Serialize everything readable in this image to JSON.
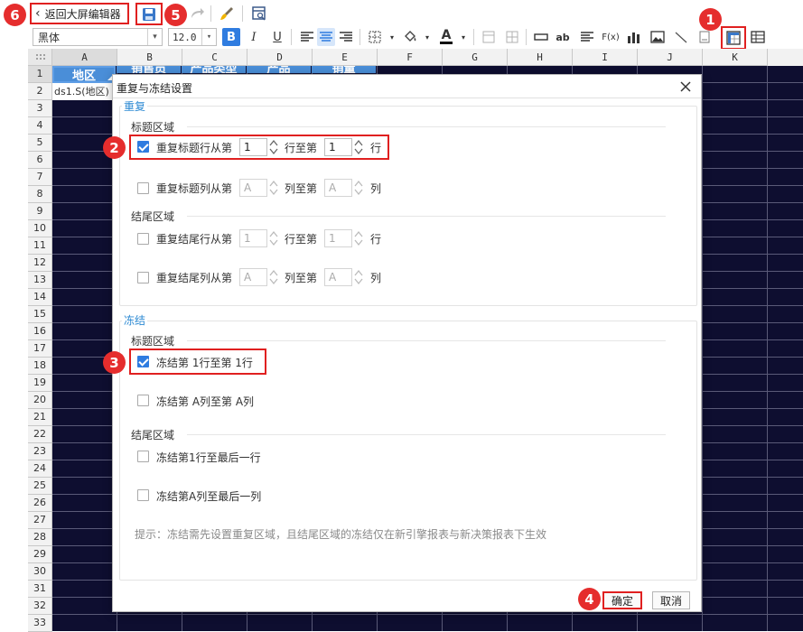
{
  "toolbar": {
    "back_label": "返回大屏编辑器",
    "font_name": "黑体",
    "font_size": "12.0",
    "bold_label": "B",
    "italic_label": "I",
    "underline_label": "U",
    "ab_label": "ab",
    "fx_label": "F(x)"
  },
  "sheet": {
    "columns": [
      "A",
      "B",
      "C",
      "D",
      "E",
      "F",
      "G",
      "H",
      "I",
      "J",
      "K"
    ],
    "rows": [
      "1",
      "2",
      "3",
      "4",
      "5",
      "6",
      "7",
      "8",
      "9",
      "10",
      "11",
      "12",
      "13",
      "14",
      "15",
      "16",
      "17",
      "18",
      "19",
      "20",
      "21",
      "22",
      "23",
      "24",
      "25",
      "26",
      "27",
      "28",
      "29",
      "30",
      "31",
      "32",
      "33"
    ],
    "cell_a1": "地区",
    "cell_b1": "销售员",
    "cell_c1": "产品类型",
    "cell_d1": "产品",
    "cell_e1": "销量",
    "cell_a2": "ds1.S(地区)"
  },
  "dialog": {
    "title": "重复与冻结设置",
    "repeat_group": "重复",
    "title_area": "标题区域",
    "footer_area": "结尾区域",
    "repeat_title_row": {
      "label": "重复标题行从第",
      "from": "1",
      "mid": "行至第",
      "to": "1",
      "end": "行"
    },
    "repeat_title_col": {
      "label": "重复标题列从第",
      "from": "A",
      "mid": "列至第",
      "to": "A",
      "end": "列"
    },
    "repeat_footer_row": {
      "label": "重复结尾行从第",
      "from": "1",
      "mid": "行至第",
      "to": "1",
      "end": "行"
    },
    "repeat_footer_col": {
      "label": "重复结尾列从第",
      "from": "A",
      "mid": "列至第",
      "to": "A",
      "end": "列"
    },
    "freeze_group": "冻结",
    "freeze_title_area": "标题区域",
    "freeze_footer_area": "结尾区域",
    "freeze_row": "冻结第 1行至第 1行",
    "freeze_col": "冻结第 A列至第 A列",
    "freeze_footer_row": "冻结第1行至最后一行",
    "freeze_footer_col": "冻结第A列至最后一列",
    "hint": "提示：冻结需先设置重复区域，且结尾区域的冻结仅在新引擎报表与新决策报表下生效",
    "ok": "确定",
    "cancel": "取消"
  },
  "callouts": [
    "1",
    "2",
    "3",
    "4",
    "5",
    "6"
  ],
  "colors": {
    "accent": "#2f7ce0",
    "highlight_red": "#e02020",
    "sheet_bg": "#0e0e30",
    "header_cell": "#4a8ed8"
  }
}
